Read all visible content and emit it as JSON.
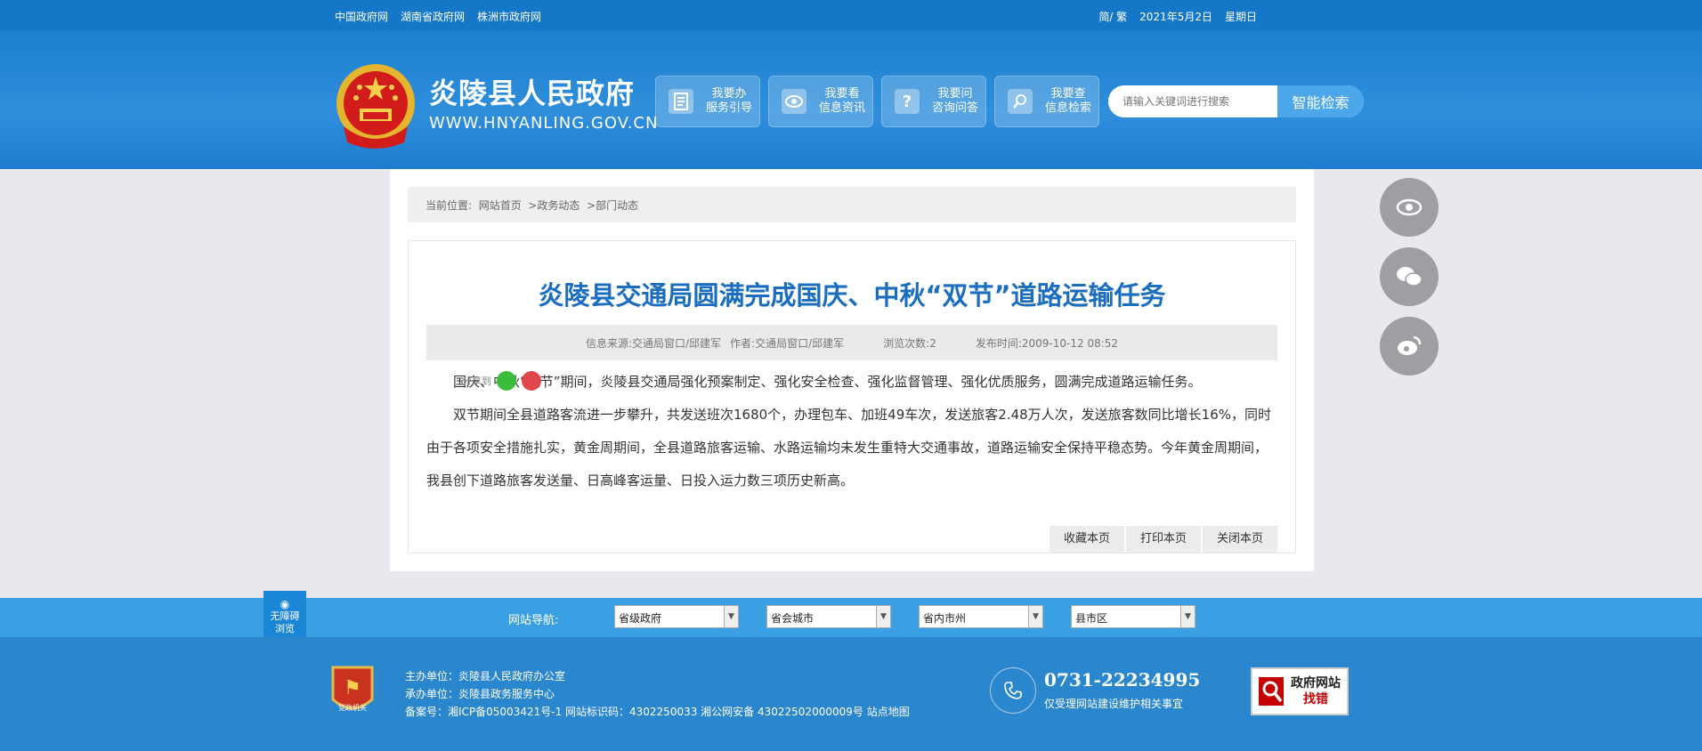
{
  "topbar": {
    "links": [
      "中国政府网",
      "湖南省政府网",
      "株洲市政府网"
    ],
    "lang": "简/ 繁",
    "date": "2021年5月2日",
    "weekday": "星期日"
  },
  "header": {
    "site_name": "炎陵县人民政府",
    "site_url": "WWW.HNYANLING.GOV.CN",
    "quick_buttons": [
      {
        "line1": "我要办",
        "line2": "服务引导",
        "icon": "document-icon"
      },
      {
        "line1": "我要看",
        "line2": "信息资讯",
        "icon": "eye-icon"
      },
      {
        "line1": "我要问",
        "line2": "咨询问答",
        "icon": "question-icon"
      },
      {
        "line1": "我要查",
        "line2": "信息检索",
        "icon": "search-icon"
      }
    ],
    "search": {
      "placeholder": "请输入关键词进行搜索",
      "button": "智能检索"
    }
  },
  "breadcrumb": {
    "prefix": "当前位置:",
    "items": [
      "网站首页",
      ">政务动态",
      ">部门动态"
    ]
  },
  "article": {
    "title": "炎陵县交通局圆满完成国庆、中秋“双节”道路运输任务",
    "meta": {
      "source": "信息来源:交通局窗口/邱建军",
      "author": "作者:交通局窗口/邱建军",
      "views": "浏览次数:2",
      "published": "发布时间:2009-10-12 08:52"
    },
    "share_label": "分享到",
    "paragraphs": [
      "国庆、中秋“双节”期间，炎陵县交通局强化预案制定、强化安全检查、强化监督管理、强化优质服务，圆满完成道路运输任务。",
      "双节期间全县道路客流进一步攀升，共发送班次1680个，办理包车、加班49车次，发送旅客2.48万人次，发送旅客数同比增长16%，同时由于各项安全措施扎实，黄金周期间，全县道路旅客运输、水路运输均未发生重特大交通事故，道路运输安全保持平稳态势。今年黄金周期间，我县创下道路旅客发送量、日高峰客运量、日投入运力数三项历史新高。"
    ],
    "buttons": [
      "收藏本页",
      "打印本页",
      "关闭本页"
    ]
  },
  "float_buttons": [
    "eye-icon",
    "wechat-icon",
    "weibo-icon"
  ],
  "site_nav": {
    "label": "网站导航:",
    "selects": [
      "省级政府",
      "省会城市",
      "省内市州",
      "县市区"
    ]
  },
  "accessibility": {
    "line1": "无障碍",
    "line2": "浏览"
  },
  "footer": {
    "sponsor": "主办单位：炎陵县人民政府办公室",
    "organizer": "承办单位：炎陵县政务服务中心",
    "record": "备案号：湘ICP备05003421号-1 网站标识码：4302250033 湘公网安备 43022502000009号 站点地图",
    "badge_text": "党政机关",
    "phone": "0731-22234995",
    "phone_note": "仅受理网站建设维护相关事宜",
    "find_fault": {
      "line1": "政府网站",
      "line2": "找错"
    }
  },
  "colors": {
    "brand_blue": "#1577c8",
    "title_blue": "#1b6dbf",
    "nav_blue": "#3aa0e3",
    "footer_blue": "#2a86cd"
  }
}
